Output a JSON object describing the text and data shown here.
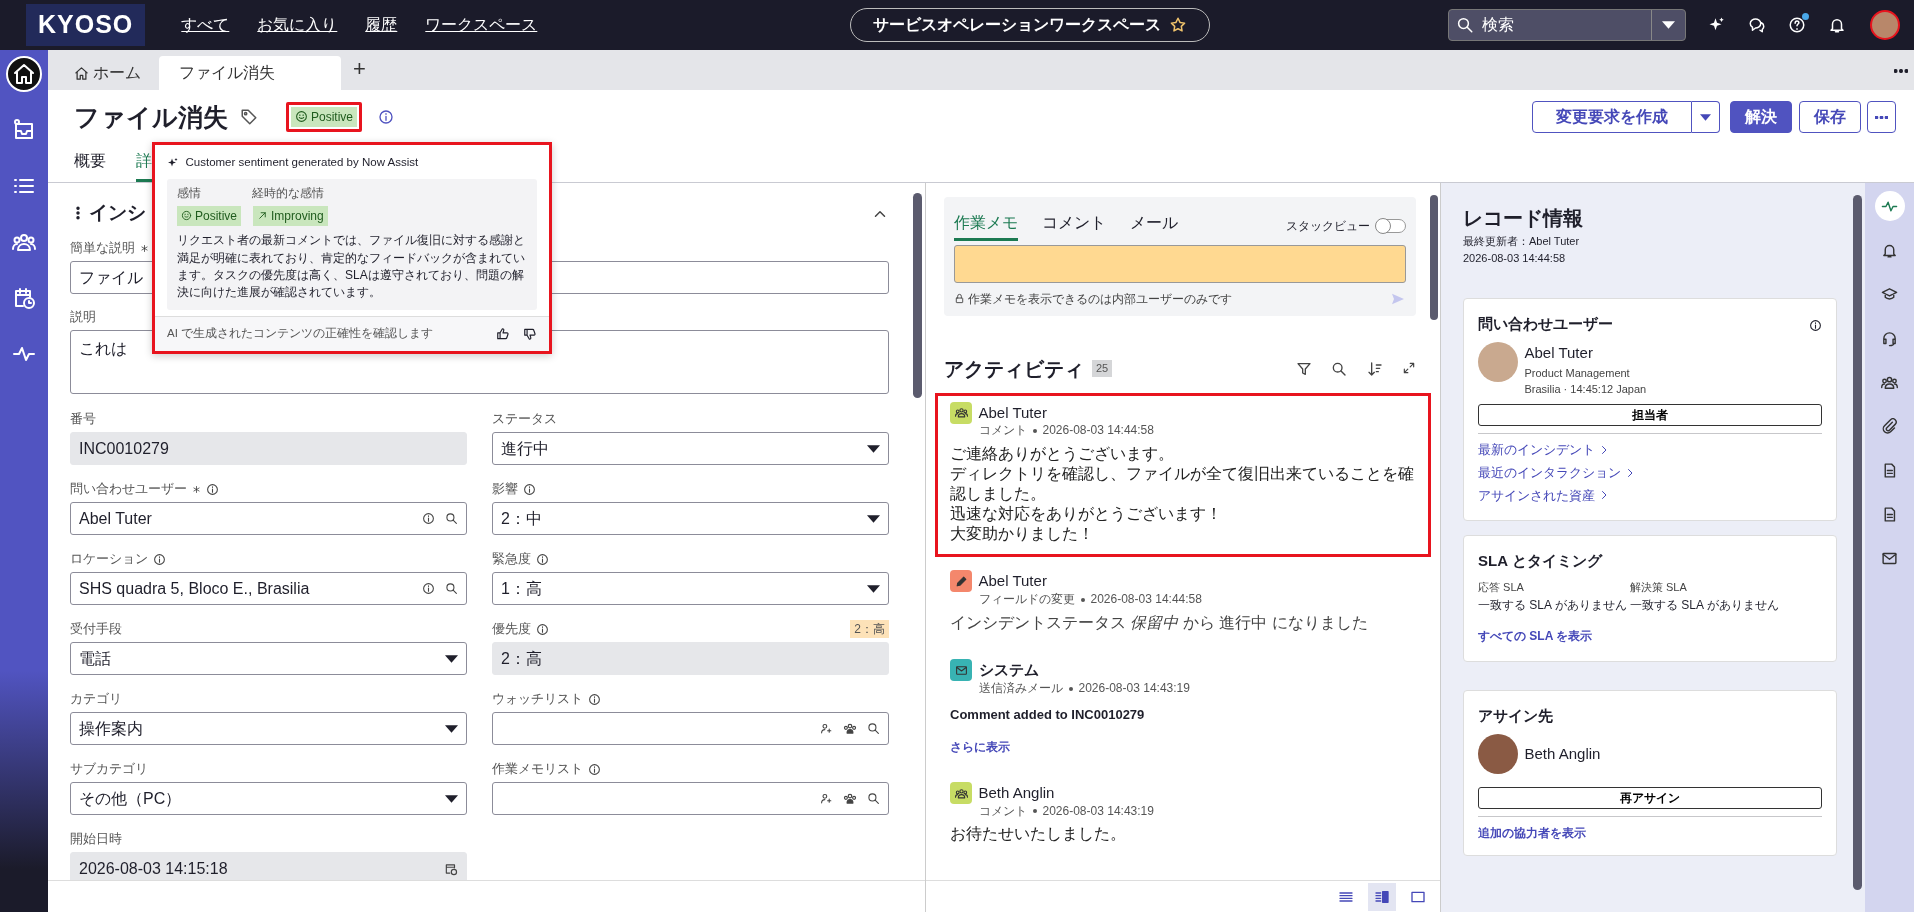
{
  "top_nav": {
    "logo": "KYOSO",
    "menu": [
      "すべて",
      "お気に入り",
      "履歴",
      "ワークスペース"
    ],
    "workspace": "サービスオペレーションワークスペース",
    "search": {
      "placeholder": "検索"
    },
    "help_badge": true
  },
  "left_rail": [
    {
      "kind": "home",
      "selected": true
    },
    {
      "kind": "inbox",
      "selected": false
    },
    {
      "kind": "list",
      "selected": false
    },
    {
      "kind": "people",
      "selected": false
    },
    {
      "kind": "calendar",
      "selected": false
    },
    {
      "kind": "pulse",
      "selected": false
    }
  ],
  "tabs": [
    {
      "label": "ホーム",
      "kind": "home",
      "selected": false
    },
    {
      "label": "ファイル消失",
      "kind": "record",
      "selected": true
    }
  ],
  "add_tab": "+",
  "record": {
    "title": "ファイル消失",
    "sentiment": {
      "label": "Positive",
      "highlighted": true
    }
  },
  "actions": [
    {
      "label": "変更要求を作成",
      "kind": "split"
    },
    {
      "label": "解決",
      "kind": "primary"
    },
    {
      "label": "保存",
      "kind": "outline"
    }
  ],
  "form_tabs": [
    {
      "label": "概要",
      "selected": false
    },
    {
      "label": "詳",
      "selected": true
    }
  ],
  "section": {
    "title": "インシ"
  },
  "summary_fields": [
    {
      "label": "簡単な説明",
      "kind": "text",
      "value": "ファイル",
      "required": true
    },
    {
      "label": "説明",
      "kind": "textarea",
      "value": "これは"
    }
  ],
  "fields": [
    {
      "label": "番号",
      "kind": "readonly",
      "value": "INC0010279"
    },
    {
      "label": "ステータス",
      "kind": "select",
      "value": "進行中"
    },
    {
      "label": "問い合わせユーザー",
      "kind": "reference",
      "value": "Abel Tuter",
      "required": true,
      "info": true
    },
    {
      "label": "影響",
      "kind": "select",
      "value": "2：中",
      "info": true
    },
    {
      "label": "ロケーション",
      "kind": "reference",
      "value": "SHS quadra 5, Bloco E., Brasilia",
      "info": true
    },
    {
      "label": "緊急度",
      "kind": "select",
      "value": "1：高",
      "info": true
    },
    {
      "label": "受付手段",
      "kind": "select",
      "value": "電話"
    },
    {
      "label": "優先度",
      "kind": "readonly",
      "value": "2：高",
      "info": true,
      "badge": "2：高"
    },
    {
      "label": "カテゴリ",
      "kind": "select",
      "value": "操作案内"
    },
    {
      "label": "ウォッチリスト",
      "kind": "list",
      "info": true
    },
    {
      "label": "サブカテゴリ",
      "kind": "select",
      "value": "その他（PC）"
    },
    {
      "label": "作業メモリスト",
      "kind": "list",
      "info": true
    },
    {
      "label": "開始日時",
      "kind": "date",
      "value": "2026-08-03 14:15:18"
    }
  ],
  "popover": {
    "title": "Customer sentiment generated by Now Assist",
    "labels": [
      "感情",
      "経時的な感情"
    ],
    "sentiment": "Positive",
    "trend": "Improving",
    "summary": "リクエスト者の最新コメントでは、ファイル復旧に対する感謝と満足が明確に表れており、肯定的なフィードバックが含まれています。タスクの優先度は高く、SLAは遵守されており、問題の解決に向けた進展が確認されています。",
    "footer": "AI で生成されたコンテンツの正確性を確認します",
    "highlighted": true
  },
  "composer": {
    "tabs": [
      {
        "label": "作業メモ",
        "selected": true
      },
      {
        "label": "コメント",
        "selected": false
      },
      {
        "label": "メール",
        "selected": false
      }
    ],
    "stack_view": {
      "label": "スタックビュー",
      "on": false
    },
    "note": "作業メモを表示できるのは内部ユーザーのみです"
  },
  "activity": {
    "title": "アクティビティ",
    "count": "25",
    "entries": [
      {
        "kind": "comment",
        "author": "Abel Tuter",
        "type": "コメント",
        "time": "2026-08-03 14:44:58",
        "lines": [
          "ご連絡ありがとうございます。",
          "ディレクトリを確認し、ファイルが全て復旧出来ていることを確認しました。",
          "迅速な対応をありがとうございます！",
          "大変助かりました！"
        ],
        "highlighted": true
      },
      {
        "kind": "field_change",
        "author": "Abel Tuter",
        "type": "フィールドの変更",
        "time": "2026-08-03 14:44:58",
        "lines": [
          "インシデントステータス *保留中* から 進行中 になりました"
        ],
        "highlighted": false
      },
      {
        "kind": "email",
        "author": "システム",
        "type": "送信済みメール",
        "time": "2026-08-03 14:43:19",
        "subject": "Comment added to INC0010279",
        "more": "さらに表示",
        "highlighted": false
      },
      {
        "kind": "comment",
        "author": "Beth Anglin",
        "type": "コメント",
        "time": "2026-08-03 14:43:19",
        "lines": [
          "お待たせいたしました。"
        ],
        "highlighted": false
      }
    ]
  },
  "view_modes": [
    {
      "kind": "list",
      "selected": false
    },
    {
      "kind": "split",
      "selected": true
    },
    {
      "kind": "single",
      "selected": false
    }
  ],
  "record_info": {
    "title": "レコード情報",
    "updated_by": "最終更新者：Abel Tuter",
    "updated_at": "2026-08-03 14:44:58",
    "caller_card": {
      "title": "問い合わせユーザー",
      "name": "Abel Tuter",
      "department": "Product Management",
      "location": "Brasilia · 14:45:12 Japan",
      "button": "担当者",
      "links": [
        "最新のインシデント",
        "最近のインタラクション",
        "アサインされた資産"
      ]
    },
    "sla_card": {
      "title": "SLA とタイミング",
      "items": [
        {
          "label": "応答 SLA",
          "value": "一致する SLA がありません"
        },
        {
          "label": "解決策 SLA",
          "value": "一致する SLA がありません"
        }
      ],
      "link": "すべての SLA を表示"
    },
    "assignee_card": {
      "title": "アサイン先",
      "name": "Beth Anglin",
      "button": "再アサイン",
      "link": "追加の協力者を表示"
    }
  },
  "right_rail": [
    {
      "kind": "pulse",
      "selected": true
    },
    {
      "kind": "bell",
      "selected": false
    },
    {
      "kind": "cap",
      "selected": false
    },
    {
      "kind": "headset",
      "selected": false
    },
    {
      "kind": "people",
      "selected": false
    },
    {
      "kind": "clip",
      "selected": false
    },
    {
      "kind": "doc",
      "selected": false
    },
    {
      "kind": "doc",
      "selected": false
    },
    {
      "kind": "mail",
      "selected": false
    }
  ]
}
